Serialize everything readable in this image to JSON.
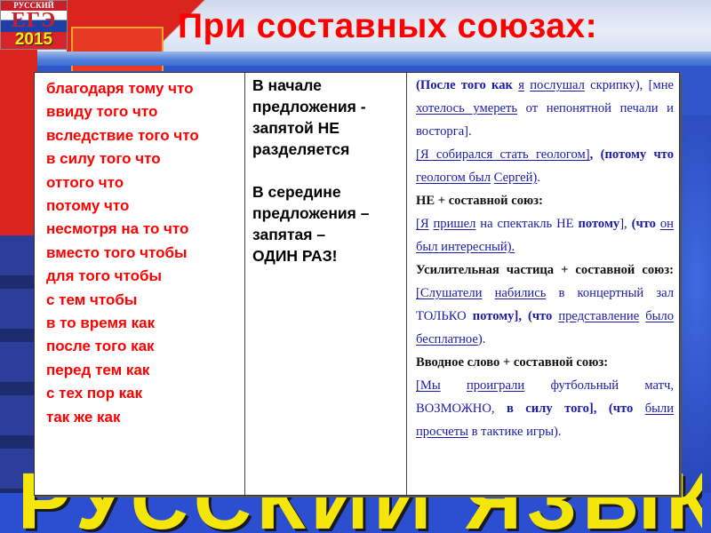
{
  "logo": {
    "subject": "РУССКИЙ ЯЗЫК",
    "exam": "ЕГЭ",
    "year": "2015"
  },
  "title": "При составных союзах:",
  "background": {
    "banner_text": "РУССКИЙ ЯЗЫК"
  },
  "table": {
    "conjunctions": [
      "благодаря тому что",
      "ввиду того что",
      "вследствие того что",
      "в силу того что",
      "оттого что",
      "потому что",
      "несмотря на то что",
      "вместо того чтобы",
      "для того чтобы",
      "с тем чтобы",
      "в то время как",
      "после того как",
      "перед тем как",
      "с тех пор как",
      "так же как"
    ],
    "rules": {
      "start": [
        "В начале",
        "предложения -",
        "запятой НЕ",
        "разделяется"
      ],
      "middle": [
        "В середине",
        "предложения –",
        "запятая –",
        "ОДИН РАЗ!"
      ]
    },
    "examples": {
      "ex1": {
        "a": "(После того как",
        "b": "я",
        "c": "послушал",
        "d": "скрипку), [мне",
        "e": "хотелось умереть",
        "f": "от непонятной печали и восторга]."
      },
      "ex2": {
        "a": "[Я собирался стать геологом]",
        "b": ",",
        "c": "(",
        "d": "потому что",
        "e": "геологом был",
        "f": "Сергей)",
        "g": "."
      },
      "hdr_ne": "НЕ + составной союз:",
      "ex3": {
        "a": "[Я",
        "b": "пришел",
        "c": "на спектакль НЕ",
        "d": "потому",
        "e": "],",
        "f": "(что",
        "g": "он",
        "h": "был интересный)."
      },
      "hdr_particle": "Усилительная частица + составной союз:",
      "ex4": {
        "a": "[Слушатели",
        "b": "набились",
        "c": "в концертный зал ТОЛЬКО",
        "d": "потому],",
        "e": "(что",
        "f": "представление",
        "g": "было бесплатное",
        "h": ")."
      },
      "hdr_intro": "Вводное слово + составной союз:",
      "ex5": {
        "a": "[Мы",
        "b": "проиграли",
        "c": "футбольный матч, ВОЗМОЖНО,",
        "d": "в силу того],",
        "e": "(что",
        "f": "были",
        "g": "просчеты",
        "h": "в тактике игры)."
      }
    }
  }
}
